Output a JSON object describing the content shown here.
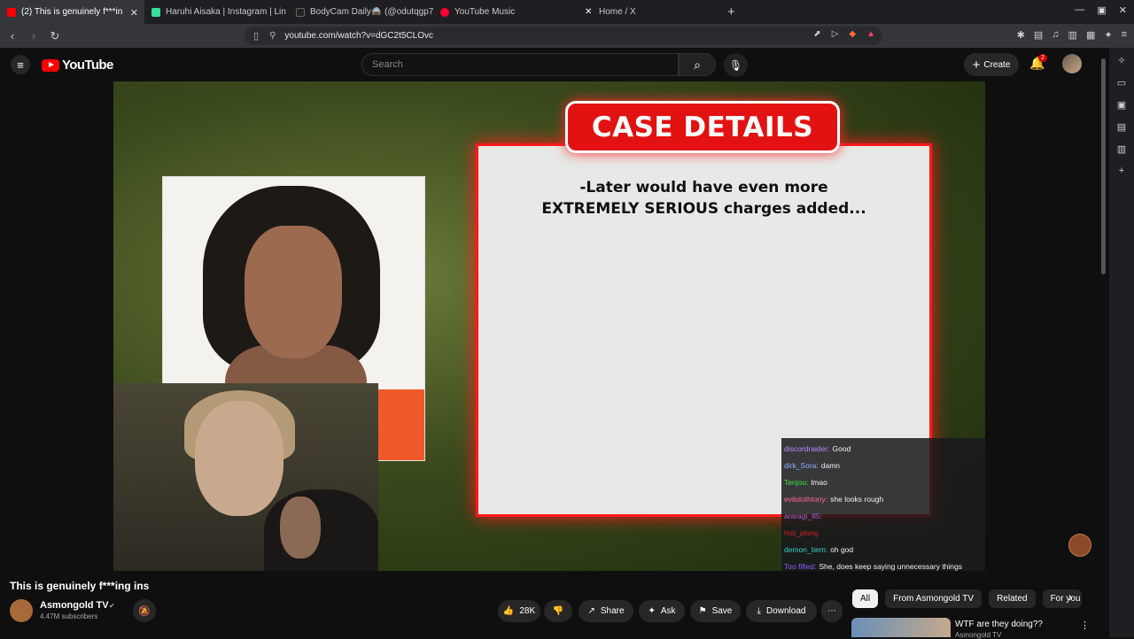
{
  "browser": {
    "tabs": [
      {
        "label": "(2) This is genuinely f***in",
        "color": "#ff0000",
        "active": true
      },
      {
        "label": "Haruhi Aisaka | Instagram | Lin",
        "color": "#39e09b",
        "active": false
      },
      {
        "label": "BodyCam Daily🚔 (@odutqgp71",
        "color": "#111111",
        "active": false
      },
      {
        "label": "YouTube Music",
        "color": "#ff0033",
        "active": false
      },
      {
        "label": "Home / X",
        "color": "#000000",
        "active": false
      }
    ],
    "url": "youtube.com/watch?v=dGC2t5CLOvc"
  },
  "youtube": {
    "logo_text": "YouTube",
    "search_placeholder": "Search",
    "create_label": "Create",
    "notification_count": "2"
  },
  "video": {
    "case_title": "CASE DETAILS",
    "case_line1": "-Later would have even more",
    "case_line2": "EXTREMELY SERIOUS charges added...",
    "chat": [
      {
        "user": "discordraider:",
        "msg": "Good",
        "color": "#b48aff"
      },
      {
        "user": "dirk_Sora:",
        "msg": "damn",
        "color": "#8ab4ff"
      },
      {
        "user": "Tenjou:",
        "msg": "lmao",
        "color": "#39e639"
      },
      {
        "user": "evilslothtony:",
        "msg": "she looks rough",
        "color": "#ff6a8a"
      },
      {
        "user": "araragi_85:",
        "msg": "",
        "color": "#9966cc"
      },
      {
        "user": "holi_plong",
        "msg": "",
        "color": "#cc2222"
      },
      {
        "user": "demon_tiem:",
        "msg": "oh god",
        "color": "#3ad1c8"
      },
      {
        "user": "Too fified:",
        "msg": "She, does keep saying unnecessary things",
        "color": "#8a5cff"
      }
    ]
  },
  "info": {
    "title": "This is genuinely f***ing ins",
    "channel": "Asmongold TV",
    "subscribers": "4.47M subscribers",
    "likes": "28K",
    "share_label": "Share",
    "ask_label": "Ask",
    "save_label": "Save",
    "download_label": "Download"
  },
  "sidebar": {
    "chips": [
      "All",
      "From Asmongold TV",
      "Related",
      "For you"
    ],
    "rec_title": "WTF are they doing??",
    "rec_channel": "Asmongold TV"
  }
}
